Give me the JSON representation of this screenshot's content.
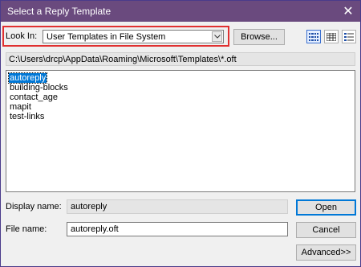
{
  "window": {
    "title": "Select a Reply Template",
    "close_glyph": "✕"
  },
  "lookin": {
    "label": "Look In:",
    "selected": "User Templates in File System"
  },
  "toolbar": {
    "browse_label": "Browse...",
    "view_icons": [
      "details-view-icon",
      "list-view-icon",
      "properties-view-icon"
    ]
  },
  "path": "C:\\Users\\drcp\\AppData\\Roaming\\Microsoft\\Templates\\*.oft",
  "files": {
    "items": [
      "autoreply",
      "building-blocks",
      "contact_age",
      "mapit",
      "test-links"
    ],
    "selected_index": 0
  },
  "display_name": {
    "label": "Display name:",
    "value": "autoreply"
  },
  "file_name": {
    "label": "File name:",
    "value": "autoreply.oft"
  },
  "buttons": {
    "open": "Open",
    "cancel": "Cancel",
    "advanced": "Advanced>>"
  },
  "colors": {
    "titlebar": "#6a4a7e",
    "highlight": "#e03030",
    "selection": "#0078d7"
  }
}
